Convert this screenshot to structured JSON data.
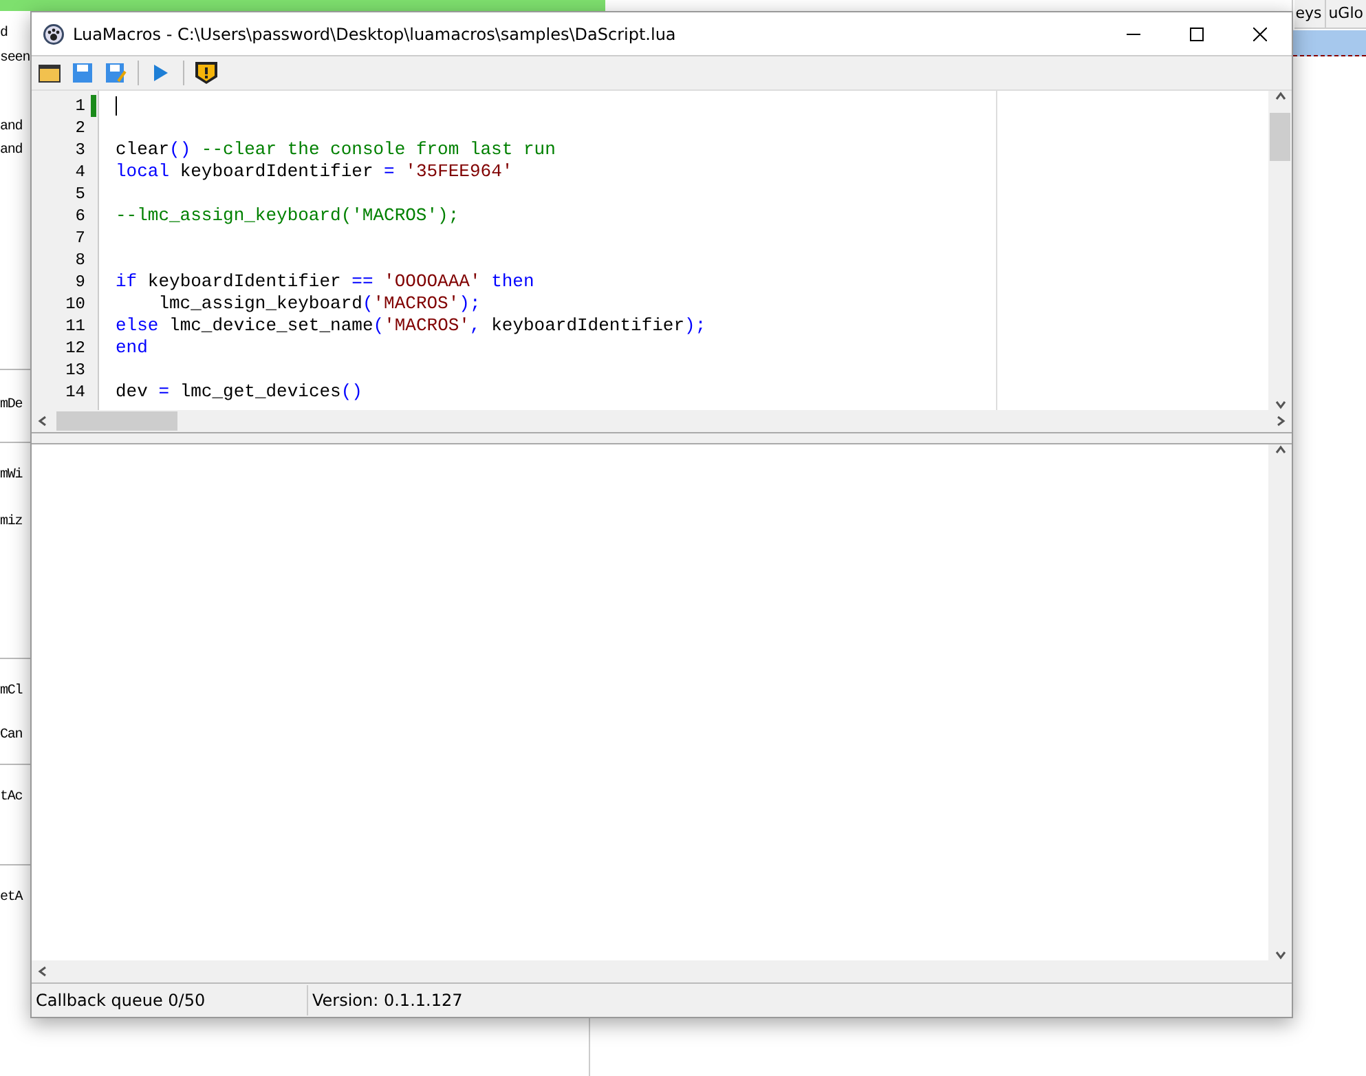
{
  "background": {
    "left_fragments": [
      "d",
      "seen",
      "and",
      "and",
      "mDe",
      "mWi",
      "miz",
      "mCl",
      "Can",
      "tAc",
      "etA"
    ],
    "tabs": [
      "eys",
      "uGlo"
    ]
  },
  "window": {
    "title": "LuaMacros - C:\\Users\\password\\Desktop\\luamacros\\samples\\DaScript.lua"
  },
  "editor": {
    "lines": [
      {
        "number": "1",
        "marked": true
      },
      {
        "number": "2",
        "marked": false
      },
      {
        "number": "3",
        "marked": false,
        "segments": [
          {
            "kind": "plain",
            "text": "clear"
          },
          {
            "kind": "punct",
            "text": "()"
          },
          {
            "kind": "comment",
            "text": " --clear the console from last run"
          }
        ]
      },
      {
        "number": "4",
        "marked": false,
        "segments": [
          {
            "kind": "keyword",
            "text": "local"
          },
          {
            "kind": "plain",
            "text": " keyboardIdentifier "
          },
          {
            "kind": "punct",
            "text": "="
          },
          {
            "kind": "string",
            "text": " '35FEE964'"
          }
        ]
      },
      {
        "number": "5",
        "marked": false
      },
      {
        "number": "6",
        "marked": false,
        "segments": [
          {
            "kind": "comment",
            "text": "--lmc_assign_keyboard('MACROS');"
          }
        ]
      },
      {
        "number": "7",
        "marked": false
      },
      {
        "number": "8",
        "marked": false
      },
      {
        "number": "9",
        "marked": false,
        "segments": [
          {
            "kind": "keyword",
            "text": "if"
          },
          {
            "kind": "plain",
            "text": " keyboardIdentifier "
          },
          {
            "kind": "punct",
            "text": "=="
          },
          {
            "kind": "string",
            "text": " 'OOOOAAA'"
          },
          {
            "kind": "keyword",
            "text": " then"
          }
        ]
      },
      {
        "number": "10",
        "marked": false,
        "segments": [
          {
            "kind": "plain",
            "text": "    lmc_assign_keyboard"
          },
          {
            "kind": "punct",
            "text": "("
          },
          {
            "kind": "string",
            "text": "'MACROS'"
          },
          {
            "kind": "punct",
            "text": ");"
          }
        ]
      },
      {
        "number": "11",
        "marked": false,
        "segments": [
          {
            "kind": "keyword",
            "text": "else"
          },
          {
            "kind": "plain",
            "text": " lmc_device_set_name"
          },
          {
            "kind": "punct",
            "text": "("
          },
          {
            "kind": "string",
            "text": "'MACROS'"
          },
          {
            "kind": "punct",
            "text": ","
          },
          {
            "kind": "plain",
            "text": " keyboardIdentifier"
          },
          {
            "kind": "punct",
            "text": ");"
          }
        ]
      },
      {
        "number": "12",
        "marked": false,
        "segments": [
          {
            "kind": "keyword",
            "text": "end"
          }
        ]
      },
      {
        "number": "13",
        "marked": false
      },
      {
        "number": "14",
        "marked": false,
        "segments": [
          {
            "kind": "plain",
            "text": "dev "
          },
          {
            "kind": "punct",
            "text": "="
          },
          {
            "kind": "plain",
            "text": " lmc_get_devices"
          },
          {
            "kind": "punct",
            "text": "()"
          }
        ]
      }
    ]
  },
  "status_bar": [
    "Callback queue 0/50",
    "Version: 0.1.1.127"
  ]
}
